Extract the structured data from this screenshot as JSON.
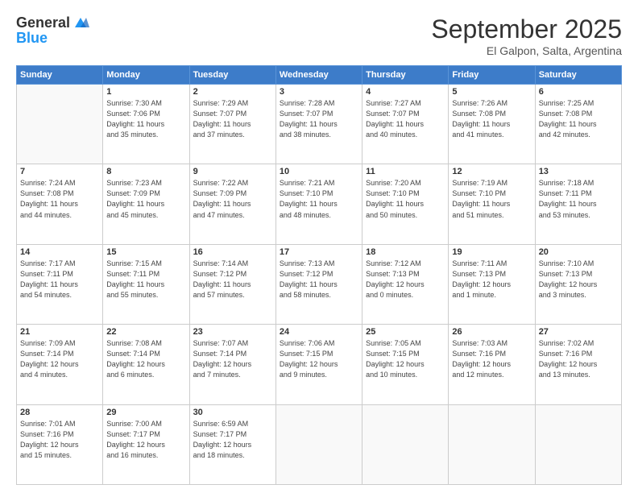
{
  "header": {
    "logo_general": "General",
    "logo_blue": "Blue",
    "month_title": "September 2025",
    "subtitle": "El Galpon, Salta, Argentina"
  },
  "weekdays": [
    "Sunday",
    "Monday",
    "Tuesday",
    "Wednesday",
    "Thursday",
    "Friday",
    "Saturday"
  ],
  "weeks": [
    [
      {
        "day": "",
        "info": ""
      },
      {
        "day": "1",
        "info": "Sunrise: 7:30 AM\nSunset: 7:06 PM\nDaylight: 11 hours\nand 35 minutes."
      },
      {
        "day": "2",
        "info": "Sunrise: 7:29 AM\nSunset: 7:07 PM\nDaylight: 11 hours\nand 37 minutes."
      },
      {
        "day": "3",
        "info": "Sunrise: 7:28 AM\nSunset: 7:07 PM\nDaylight: 11 hours\nand 38 minutes."
      },
      {
        "day": "4",
        "info": "Sunrise: 7:27 AM\nSunset: 7:07 PM\nDaylight: 11 hours\nand 40 minutes."
      },
      {
        "day": "5",
        "info": "Sunrise: 7:26 AM\nSunset: 7:08 PM\nDaylight: 11 hours\nand 41 minutes."
      },
      {
        "day": "6",
        "info": "Sunrise: 7:25 AM\nSunset: 7:08 PM\nDaylight: 11 hours\nand 42 minutes."
      }
    ],
    [
      {
        "day": "7",
        "info": "Sunrise: 7:24 AM\nSunset: 7:08 PM\nDaylight: 11 hours\nand 44 minutes."
      },
      {
        "day": "8",
        "info": "Sunrise: 7:23 AM\nSunset: 7:09 PM\nDaylight: 11 hours\nand 45 minutes."
      },
      {
        "day": "9",
        "info": "Sunrise: 7:22 AM\nSunset: 7:09 PM\nDaylight: 11 hours\nand 47 minutes."
      },
      {
        "day": "10",
        "info": "Sunrise: 7:21 AM\nSunset: 7:10 PM\nDaylight: 11 hours\nand 48 minutes."
      },
      {
        "day": "11",
        "info": "Sunrise: 7:20 AM\nSunset: 7:10 PM\nDaylight: 11 hours\nand 50 minutes."
      },
      {
        "day": "12",
        "info": "Sunrise: 7:19 AM\nSunset: 7:10 PM\nDaylight: 11 hours\nand 51 minutes."
      },
      {
        "day": "13",
        "info": "Sunrise: 7:18 AM\nSunset: 7:11 PM\nDaylight: 11 hours\nand 53 minutes."
      }
    ],
    [
      {
        "day": "14",
        "info": "Sunrise: 7:17 AM\nSunset: 7:11 PM\nDaylight: 11 hours\nand 54 minutes."
      },
      {
        "day": "15",
        "info": "Sunrise: 7:15 AM\nSunset: 7:11 PM\nDaylight: 11 hours\nand 55 minutes."
      },
      {
        "day": "16",
        "info": "Sunrise: 7:14 AM\nSunset: 7:12 PM\nDaylight: 11 hours\nand 57 minutes."
      },
      {
        "day": "17",
        "info": "Sunrise: 7:13 AM\nSunset: 7:12 PM\nDaylight: 11 hours\nand 58 minutes."
      },
      {
        "day": "18",
        "info": "Sunrise: 7:12 AM\nSunset: 7:13 PM\nDaylight: 12 hours\nand 0 minutes."
      },
      {
        "day": "19",
        "info": "Sunrise: 7:11 AM\nSunset: 7:13 PM\nDaylight: 12 hours\nand 1 minute."
      },
      {
        "day": "20",
        "info": "Sunrise: 7:10 AM\nSunset: 7:13 PM\nDaylight: 12 hours\nand 3 minutes."
      }
    ],
    [
      {
        "day": "21",
        "info": "Sunrise: 7:09 AM\nSunset: 7:14 PM\nDaylight: 12 hours\nand 4 minutes."
      },
      {
        "day": "22",
        "info": "Sunrise: 7:08 AM\nSunset: 7:14 PM\nDaylight: 12 hours\nand 6 minutes."
      },
      {
        "day": "23",
        "info": "Sunrise: 7:07 AM\nSunset: 7:14 PM\nDaylight: 12 hours\nand 7 minutes."
      },
      {
        "day": "24",
        "info": "Sunrise: 7:06 AM\nSunset: 7:15 PM\nDaylight: 12 hours\nand 9 minutes."
      },
      {
        "day": "25",
        "info": "Sunrise: 7:05 AM\nSunset: 7:15 PM\nDaylight: 12 hours\nand 10 minutes."
      },
      {
        "day": "26",
        "info": "Sunrise: 7:03 AM\nSunset: 7:16 PM\nDaylight: 12 hours\nand 12 minutes."
      },
      {
        "day": "27",
        "info": "Sunrise: 7:02 AM\nSunset: 7:16 PM\nDaylight: 12 hours\nand 13 minutes."
      }
    ],
    [
      {
        "day": "28",
        "info": "Sunrise: 7:01 AM\nSunset: 7:16 PM\nDaylight: 12 hours\nand 15 minutes."
      },
      {
        "day": "29",
        "info": "Sunrise: 7:00 AM\nSunset: 7:17 PM\nDaylight: 12 hours\nand 16 minutes."
      },
      {
        "day": "30",
        "info": "Sunrise: 6:59 AM\nSunset: 7:17 PM\nDaylight: 12 hours\nand 18 minutes."
      },
      {
        "day": "",
        "info": ""
      },
      {
        "day": "",
        "info": ""
      },
      {
        "day": "",
        "info": ""
      },
      {
        "day": "",
        "info": ""
      }
    ]
  ]
}
